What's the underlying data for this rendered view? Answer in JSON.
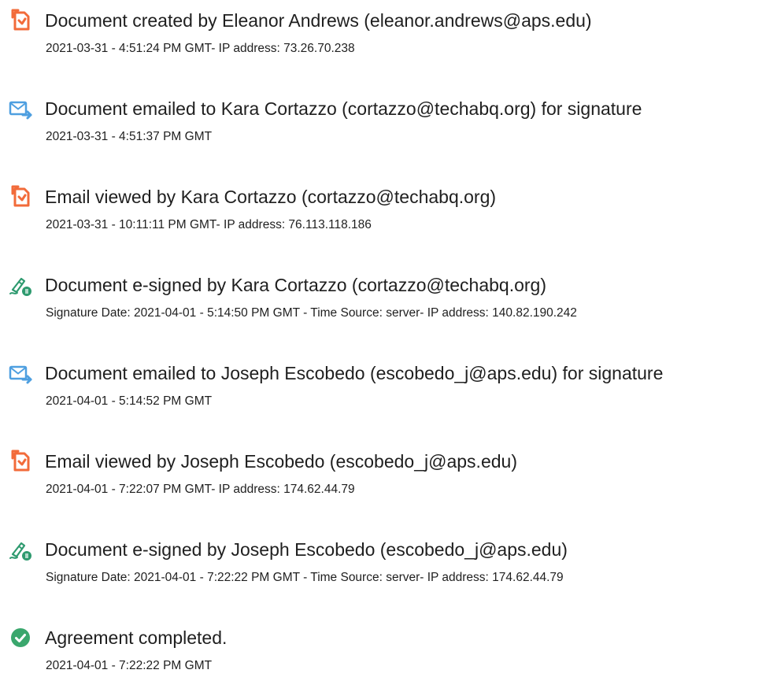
{
  "colors": {
    "created_icon": "#f26b3a",
    "email_icon": "#4e9fe0",
    "signed_icon_pen": "#2e9a6f",
    "completed_icon": "#3aa76d",
    "text": "#1f1f1f"
  },
  "events": [
    {
      "icon": "document-created-icon",
      "title": "Document created by Eleanor Andrews (eleanor.andrews@aps.edu)",
      "detail": "2021-03-31 - 4:51:24 PM GMT- IP address: 73.26.70.238"
    },
    {
      "icon": "email-sent-icon",
      "title": "Document emailed to Kara Cortazzo (cortazzo@techabq.org) for signature",
      "detail": "2021-03-31 - 4:51:37 PM GMT"
    },
    {
      "icon": "email-viewed-icon",
      "title": "Email viewed by Kara Cortazzo (cortazzo@techabq.org)",
      "detail": "2021-03-31 - 10:11:11 PM GMT- IP address: 76.113.118.186"
    },
    {
      "icon": "esign-icon",
      "title": "Document e-signed by Kara Cortazzo (cortazzo@techabq.org)",
      "detail": "Signature Date: 2021-04-01 - 5:14:50 PM GMT - Time Source: server- IP address: 140.82.190.242"
    },
    {
      "icon": "email-sent-icon",
      "title": "Document emailed to Joseph Escobedo (escobedo_j@aps.edu) for signature",
      "detail": "2021-04-01 - 5:14:52 PM GMT"
    },
    {
      "icon": "email-viewed-icon",
      "title": "Email viewed by Joseph Escobedo (escobedo_j@aps.edu)",
      "detail": "2021-04-01 - 7:22:07 PM GMT- IP address: 174.62.44.79"
    },
    {
      "icon": "esign-icon",
      "title": "Document e-signed by Joseph Escobedo (escobedo_j@aps.edu)",
      "detail": "Signature Date: 2021-04-01 - 7:22:22 PM GMT - Time Source: server- IP address: 174.62.44.79"
    },
    {
      "icon": "completed-check-icon",
      "title": "Agreement completed.",
      "detail": "2021-04-01 - 7:22:22 PM GMT"
    }
  ]
}
